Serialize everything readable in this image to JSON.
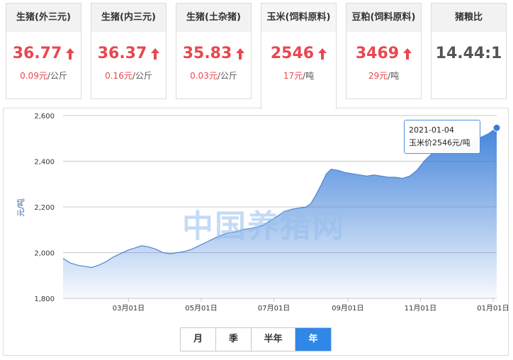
{
  "cards": [
    {
      "title": "生猪(外三元)",
      "price": "36.77",
      "change": "0.09元",
      "unit": "/公斤",
      "trend": "up"
    },
    {
      "title": "生猪(内三元)",
      "price": "36.37",
      "change": "0.16元",
      "unit": "/公斤",
      "trend": "up"
    },
    {
      "title": "生猪(土杂猪)",
      "price": "35.83",
      "change": "0.03元",
      "unit": "/公斤",
      "trend": "up"
    },
    {
      "title": "玉米(饲料原料)",
      "price": "2546",
      "change": "17元",
      "unit": "/吨",
      "trend": "up",
      "active": true
    },
    {
      "title": "豆粕(饲料原料)",
      "price": "3469",
      "change": "29元",
      "unit": "/吨",
      "trend": "up"
    },
    {
      "title": "猪粮比",
      "price": "14.44:1"
    }
  ],
  "watermark": "中国养猪网",
  "tooltip": {
    "date": "2021-01-04",
    "text": "玉米价2546元/吨"
  },
  "range_tabs": [
    {
      "label": "月",
      "active": false
    },
    {
      "label": "季",
      "active": false
    },
    {
      "label": "半年",
      "active": false
    },
    {
      "label": "年",
      "active": true
    }
  ],
  "colors": {
    "up": "#e8474f",
    "accent": "#2f88e8",
    "line": "#4a86d6"
  },
  "chart_data": {
    "type": "area",
    "ylabel": "元/吨",
    "ylim": [
      1800,
      2600
    ],
    "yticks": [
      "1,800",
      "2,000",
      "2,200",
      "2,400",
      "2,600"
    ],
    "ytick_values": [
      1800,
      2000,
      2200,
      2400,
      2600
    ],
    "xticks": [
      "03月01日",
      "05月01日",
      "07月01日",
      "09月01日",
      "11月01日",
      "01月01日"
    ],
    "xtick_dates": [
      "2020-03-01",
      "2020-05-01",
      "2020-07-01",
      "2020-09-01",
      "2020-11-01",
      "2021-01-01"
    ],
    "grid": true,
    "series": [
      {
        "values": [
          [
            "2020-01-06",
            1975
          ],
          [
            "2020-01-12",
            1955
          ],
          [
            "2020-01-18",
            1945
          ],
          [
            "2020-01-24",
            1940
          ],
          [
            "2020-01-30",
            1935
          ],
          [
            "2020-02-05",
            1945
          ],
          [
            "2020-02-11",
            1960
          ],
          [
            "2020-02-17",
            1980
          ],
          [
            "2020-02-23",
            1995
          ],
          [
            "2020-02-29",
            2010
          ],
          [
            "2020-03-06",
            2020
          ],
          [
            "2020-03-12",
            2030
          ],
          [
            "2020-03-18",
            2025
          ],
          [
            "2020-03-24",
            2015
          ],
          [
            "2020-03-30",
            2000
          ],
          [
            "2020-04-05",
            1995
          ],
          [
            "2020-04-11",
            2000
          ],
          [
            "2020-04-17",
            2005
          ],
          [
            "2020-04-23",
            2015
          ],
          [
            "2020-04-29",
            2030
          ],
          [
            "2020-05-05",
            2045
          ],
          [
            "2020-05-11",
            2060
          ],
          [
            "2020-05-17",
            2075
          ],
          [
            "2020-05-23",
            2085
          ],
          [
            "2020-05-29",
            2090
          ],
          [
            "2020-06-04",
            2100
          ],
          [
            "2020-06-10",
            2105
          ],
          [
            "2020-06-16",
            2110
          ],
          [
            "2020-06-22",
            2120
          ],
          [
            "2020-06-28",
            2140
          ],
          [
            "2020-07-04",
            2160
          ],
          [
            "2020-07-10",
            2180
          ],
          [
            "2020-07-16",
            2190
          ],
          [
            "2020-07-22",
            2195
          ],
          [
            "2020-07-28",
            2200
          ],
          [
            "2020-08-01",
            2215
          ],
          [
            "2020-08-05",
            2250
          ],
          [
            "2020-08-10",
            2300
          ],
          [
            "2020-08-14",
            2345
          ],
          [
            "2020-08-18",
            2365
          ],
          [
            "2020-08-24",
            2360
          ],
          [
            "2020-08-30",
            2350
          ],
          [
            "2020-09-05",
            2345
          ],
          [
            "2020-09-11",
            2340
          ],
          [
            "2020-09-17",
            2335
          ],
          [
            "2020-09-23",
            2340
          ],
          [
            "2020-09-29",
            2335
          ],
          [
            "2020-10-05",
            2330
          ],
          [
            "2020-10-11",
            2330
          ],
          [
            "2020-10-17",
            2325
          ],
          [
            "2020-10-23",
            2335
          ],
          [
            "2020-10-29",
            2360
          ],
          [
            "2020-11-04",
            2400
          ],
          [
            "2020-11-10",
            2430
          ],
          [
            "2020-11-16",
            2450
          ],
          [
            "2020-11-22",
            2460
          ],
          [
            "2020-11-28",
            2470
          ],
          [
            "2020-12-04",
            2475
          ],
          [
            "2020-12-10",
            2485
          ],
          [
            "2020-12-16",
            2495
          ],
          [
            "2020-12-22",
            2505
          ],
          [
            "2020-12-28",
            2520
          ],
          [
            "2021-01-04",
            2546
          ]
        ]
      }
    ]
  }
}
